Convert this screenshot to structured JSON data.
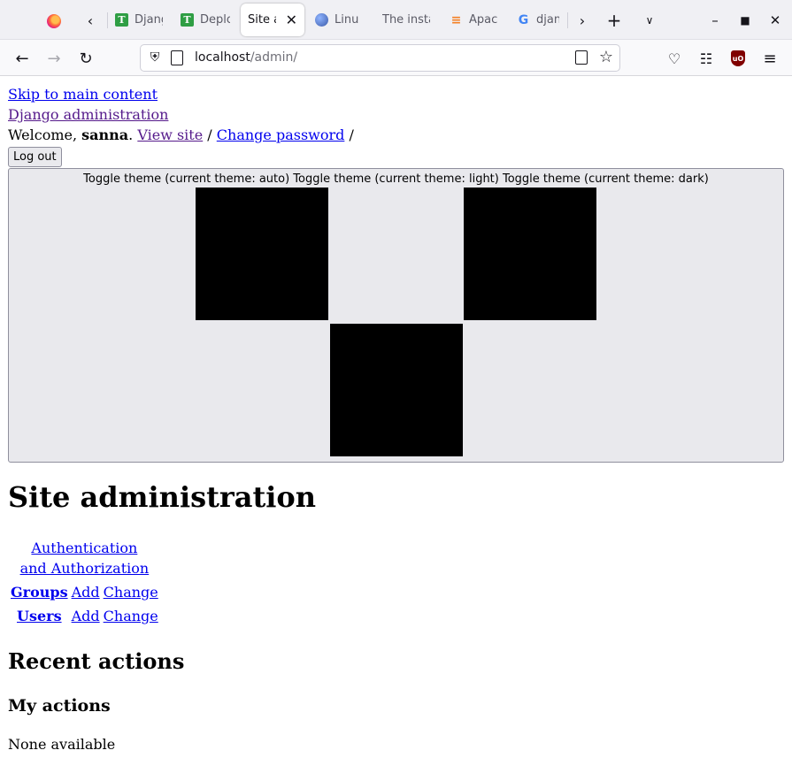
{
  "browser": {
    "tabs": [
      {
        "title": "Djang",
        "icon": "t-favicon"
      },
      {
        "title": "Deplo",
        "icon": "t-favicon"
      },
      {
        "title": "Site ad",
        "icon": "none",
        "active": true
      },
      {
        "title": "Linux",
        "icon": "globe-favicon"
      },
      {
        "title": "The insta",
        "icon": "none"
      },
      {
        "title": "Apach",
        "icon": "stackoverflow-favicon"
      },
      {
        "title": "djang",
        "icon": "google-favicon"
      }
    ],
    "url_host": "localhost",
    "url_path": "/admin/"
  },
  "header": {
    "skip_link": "Skip to main content",
    "branding": "Django administration",
    "welcome_prefix": "Welcome, ",
    "username": "sanna",
    "welcome_suffix": ". ",
    "view_site": "View site",
    "sep1": " / ",
    "change_password": "Change password",
    "sep2": " /",
    "logout": "Log out"
  },
  "theme_toggle": {
    "label": "Toggle theme (current theme: auto) Toggle theme (current theme: light) Toggle theme (current theme: dark)"
  },
  "main": {
    "title": "Site administration",
    "apps": [
      {
        "caption": "Authentication and Authorization",
        "models": [
          {
            "name": "Groups",
            "add": "Add",
            "change": "Change"
          },
          {
            "name": "Users",
            "add": "Add",
            "change": "Change"
          }
        ]
      }
    ],
    "recent_actions": "Recent actions",
    "my_actions": "My actions",
    "none_available": "None available"
  }
}
